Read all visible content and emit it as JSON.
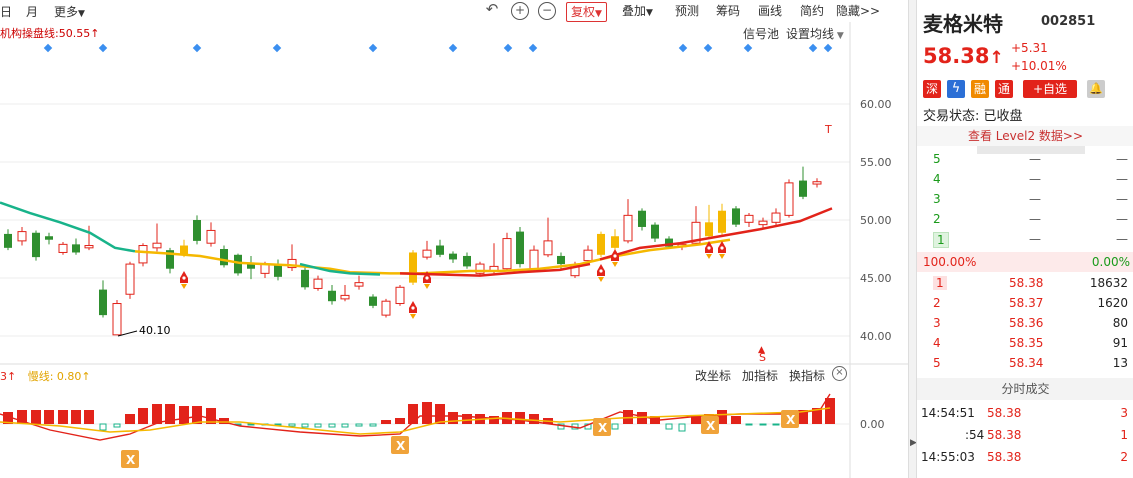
{
  "toolbar": {
    "day_label": "日",
    "month_label": "月",
    "more_label": "更多",
    "undo_icon": "undo-icon",
    "zoom_in_icon": "zoom-in-icon",
    "zoom_out_icon": "zoom-out-icon",
    "fuquan_label": "复权",
    "overlay_label": "叠加",
    "forecast_label": "预测",
    "chips_label": "筹码",
    "draw_label": "画线",
    "simple_label": "简约",
    "hide_label": "隐藏>>"
  },
  "main_chart": {
    "indicator_label": "机构操盘线:50.55",
    "indicator_arrow": "↑",
    "signal_pool_label": "信号池",
    "set_ma_label": "设置均线",
    "y_ticks": [
      "60.00",
      "55.00",
      "50.00",
      "45.00",
      "40.00"
    ],
    "low_annotation": "40.10",
    "t_marker": "T",
    "s_marker": "S"
  },
  "sub_chart": {
    "fast_label": "3",
    "slow_label": "慢线: 0.80",
    "slow_arrow": "↑",
    "change_coord_label": "改坐标",
    "add_indicator_label": "加指标",
    "switch_indicator_label": "换指标",
    "y_tick": "0.00",
    "x_marker_label": "X"
  },
  "stock": {
    "name": "麦格米特",
    "code": "002851",
    "price": "58.38",
    "price_arrow": "↑",
    "change": "+5.31",
    "change_pct": "+10.01%",
    "badges": [
      "深",
      "融",
      "通"
    ],
    "add_watch": "+自选",
    "trade_status": "交易状态: 已收盘",
    "level2_link": "查看 Level2 数据>>"
  },
  "order_book": {
    "asks": [
      {
        "level": "5",
        "price": "—",
        "vol": "—"
      },
      {
        "level": "4",
        "price": "—",
        "vol": "—"
      },
      {
        "level": "3",
        "price": "—",
        "vol": "—"
      },
      {
        "level": "2",
        "price": "—",
        "vol": "—"
      },
      {
        "level": "1",
        "price": "—",
        "vol": "—"
      }
    ],
    "ratio_left": "100.00%",
    "ratio_right": "0.00%",
    "bids": [
      {
        "level": "1",
        "price": "58.38",
        "vol": "18632"
      },
      {
        "level": "2",
        "price": "58.37",
        "vol": "1620"
      },
      {
        "level": "3",
        "price": "58.36",
        "vol": "80"
      },
      {
        "level": "4",
        "price": "58.35",
        "vol": "91"
      },
      {
        "level": "5",
        "price": "58.34",
        "vol": "13"
      }
    ]
  },
  "trades": {
    "title": "分时成交",
    "rows": [
      {
        "time": "14:54:51",
        "price": "58.38",
        "vol": "3"
      },
      {
        "time": ":54",
        "price": "58.38",
        "vol": "1"
      },
      {
        "time": "14:55:03",
        "price": "58.38",
        "vol": "2"
      }
    ]
  },
  "colors": {
    "up": "#e2231a",
    "down": "#2f8f2f",
    "accent_yellow": "#f5b800",
    "teal_line": "#18b38a",
    "diamond_blue": "#3b8ff0"
  }
}
